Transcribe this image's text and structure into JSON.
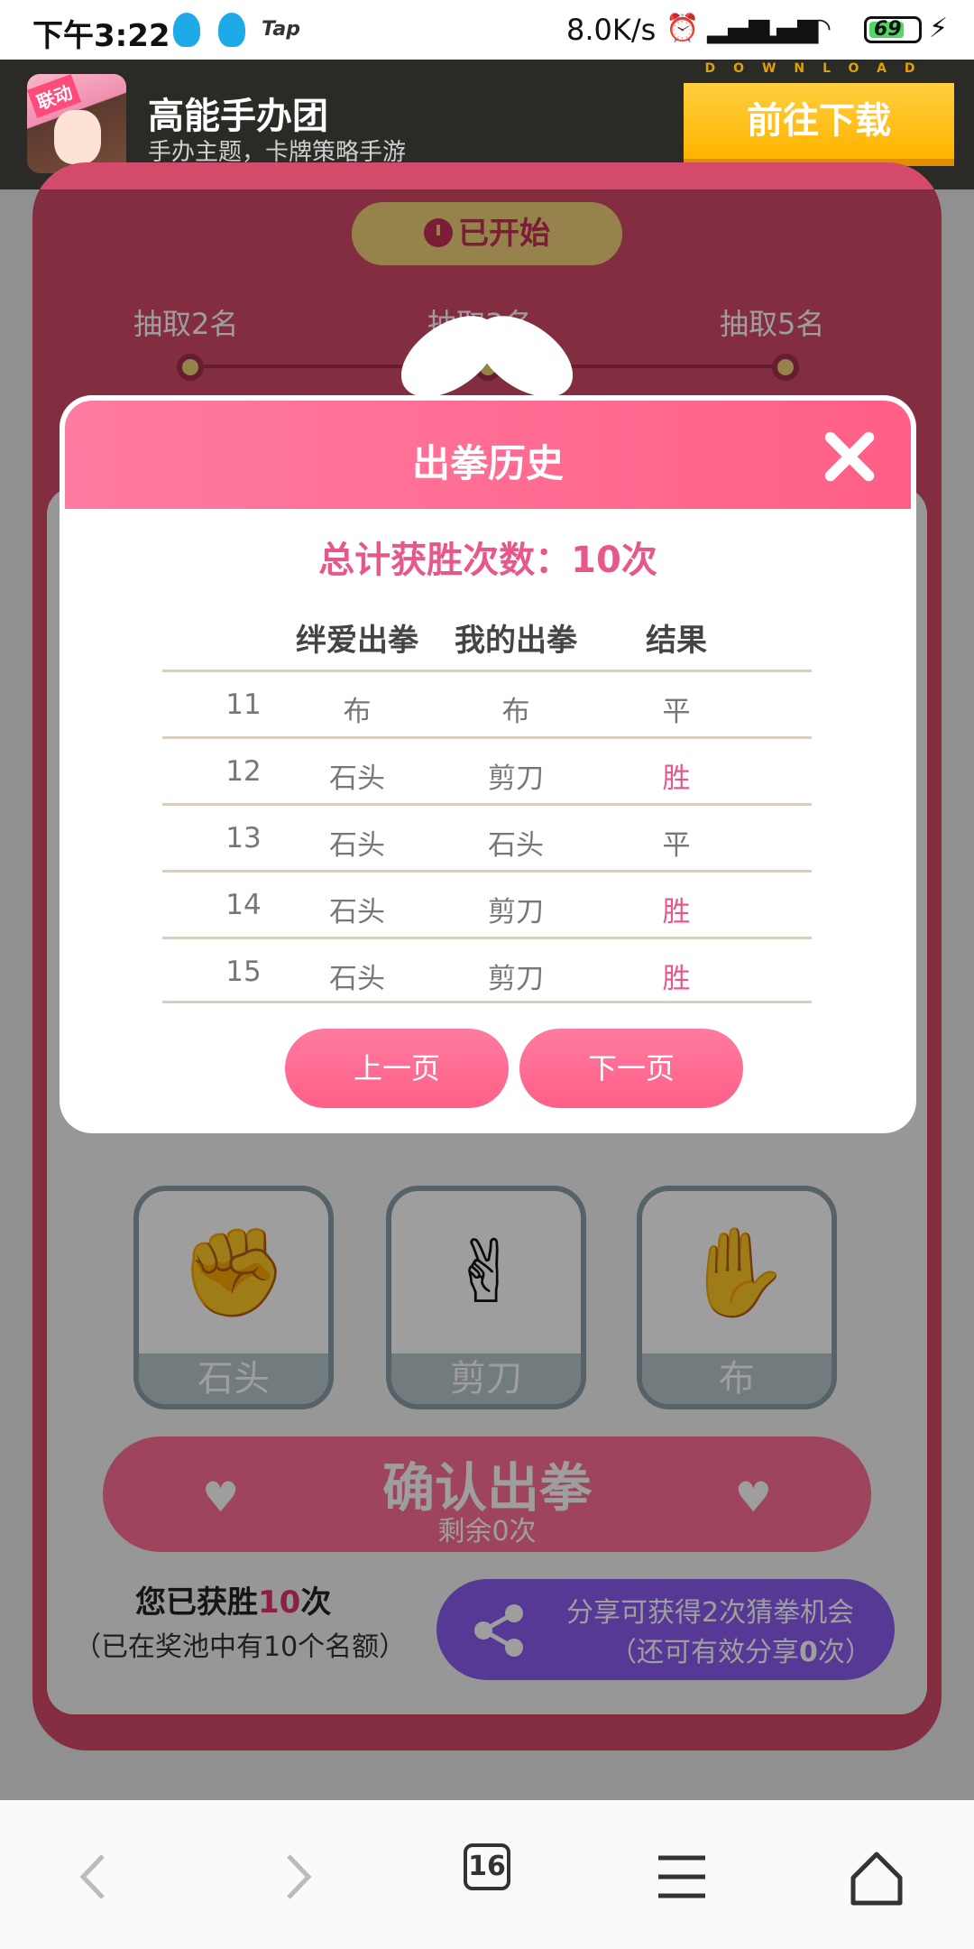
{
  "status_bar": {
    "time": "下午3:22",
    "tap_label": "Tap",
    "net_speed": "8.0K/s",
    "battery": "69"
  },
  "ad": {
    "badge": "联动",
    "title": "高能手办团",
    "subtitle": "手办主题，卡牌策略手游",
    "download_watermark": "DOWNLOAD",
    "button": "前往下载"
  },
  "game": {
    "status": "已开始",
    "tiers": [
      "抽取2名",
      "抽取3名",
      "抽取5名"
    ],
    "choices": [
      {
        "label": "石头",
        "icon": "rock-hand-icon"
      },
      {
        "label": "剪刀",
        "icon": "scissors-hand-icon"
      },
      {
        "label": "布",
        "icon": "paper-hand-icon"
      }
    ],
    "confirm": {
      "label": "确认出拳",
      "remaining": "剩余0次"
    },
    "wins": {
      "prefix": "您已获胜",
      "count": "10",
      "suffix": "次",
      "sub": "（已在奖池中有10个名额）"
    },
    "share": {
      "line1": "分享可获得2次猜拳机会",
      "line2_prefix": "（还可有效分享",
      "line2_count": "0",
      "line2_suffix": "次）"
    }
  },
  "modal": {
    "title": "出拳历史",
    "total_wins": "总计获胜次数：10次",
    "columns": [
      "",
      "绊爱出拳",
      "我的出拳",
      "结果"
    ],
    "rows": [
      {
        "no": "11",
        "opponent": "布",
        "mine": "布",
        "result": "平",
        "win": false
      },
      {
        "no": "12",
        "opponent": "石头",
        "mine": "剪刀",
        "result": "胜",
        "win": true
      },
      {
        "no": "13",
        "opponent": "石头",
        "mine": "石头",
        "result": "平",
        "win": false
      },
      {
        "no": "14",
        "opponent": "石头",
        "mine": "剪刀",
        "result": "胜",
        "win": true
      },
      {
        "no": "15",
        "opponent": "石头",
        "mine": "剪刀",
        "result": "胜",
        "win": true
      }
    ],
    "prev_page": "上一页",
    "next_page": "下一页"
  },
  "nav": {
    "tab_count": "16"
  },
  "colors": {
    "accent": "#ff5f87",
    "win": "#e8578a",
    "share": "#8a5cf0",
    "card": "#d44a6a"
  }
}
